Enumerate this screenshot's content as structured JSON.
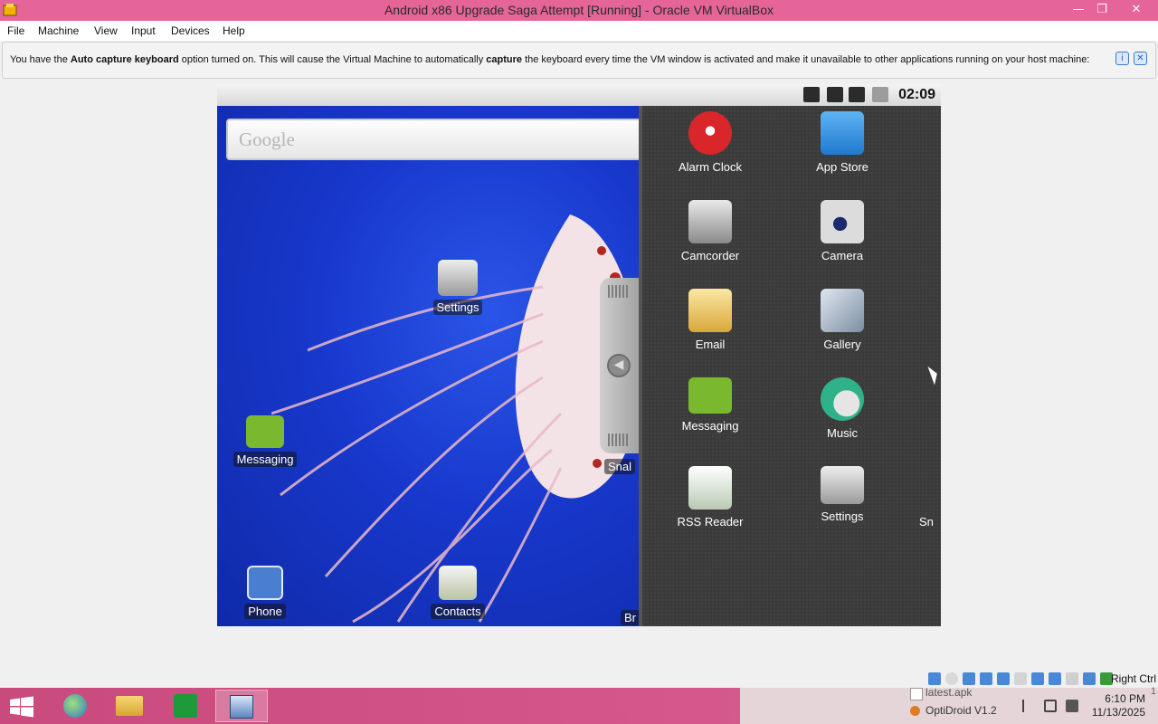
{
  "window": {
    "title": "Android x86 Upgrade Saga Attempt [Running] - Oracle VM VirtualBox",
    "minimize_label": "—",
    "restore_label": "❐",
    "close_label": "✕"
  },
  "menu": {
    "file": "File",
    "machine": "Machine",
    "view": "View",
    "input": "Input",
    "devices": "Devices",
    "help": "Help"
  },
  "notice": {
    "part1": "You have the ",
    "bold1": "Auto capture keyboard",
    "part2": " option turned on. This will cause the Virtual Machine to automatically ",
    "bold2": "capture",
    "part3": " the keyboard every time the VM window is activated and make it unavailable to other applications running on your host machine:",
    "info_icon": "i",
    "close_icon": "✕"
  },
  "android": {
    "clock": "02:09",
    "search_placeholder": "Google",
    "desktop": [
      {
        "label": "Settings"
      },
      {
        "label": "Messaging"
      },
      {
        "label": "Phone"
      },
      {
        "label": "Contacts"
      },
      {
        "label": "Snal"
      },
      {
        "label": "Br"
      }
    ],
    "drawer": [
      {
        "label": "Alarm Clock",
        "color": "#d9262b"
      },
      {
        "label": "App Store",
        "color": "#2f8fe0"
      },
      {
        "label": "Camcorder",
        "color": "#9a9a9a"
      },
      {
        "label": "Camera",
        "color": "#b9b9b9"
      },
      {
        "label": "Email",
        "color": "#e0b649"
      },
      {
        "label": "Gallery",
        "color": "#7d8b9a"
      },
      {
        "label": "Messaging",
        "color": "#7ab92e"
      },
      {
        "label": "Music",
        "color": "#2fb28a"
      },
      {
        "label": "RSS Reader",
        "color": "#e8e8e8"
      },
      {
        "label": "Settings",
        "color": "#c8c8c8"
      },
      {
        "label": "Sn"
      }
    ]
  },
  "vm_status": {
    "host_key": "Right Ctrl"
  },
  "taskbar": {
    "peek_items": [
      "latest.apk",
      "OptiDroid V1.2"
    ],
    "time": "6:10 PM",
    "date": "11/13/2025",
    "peek_right": "1"
  }
}
